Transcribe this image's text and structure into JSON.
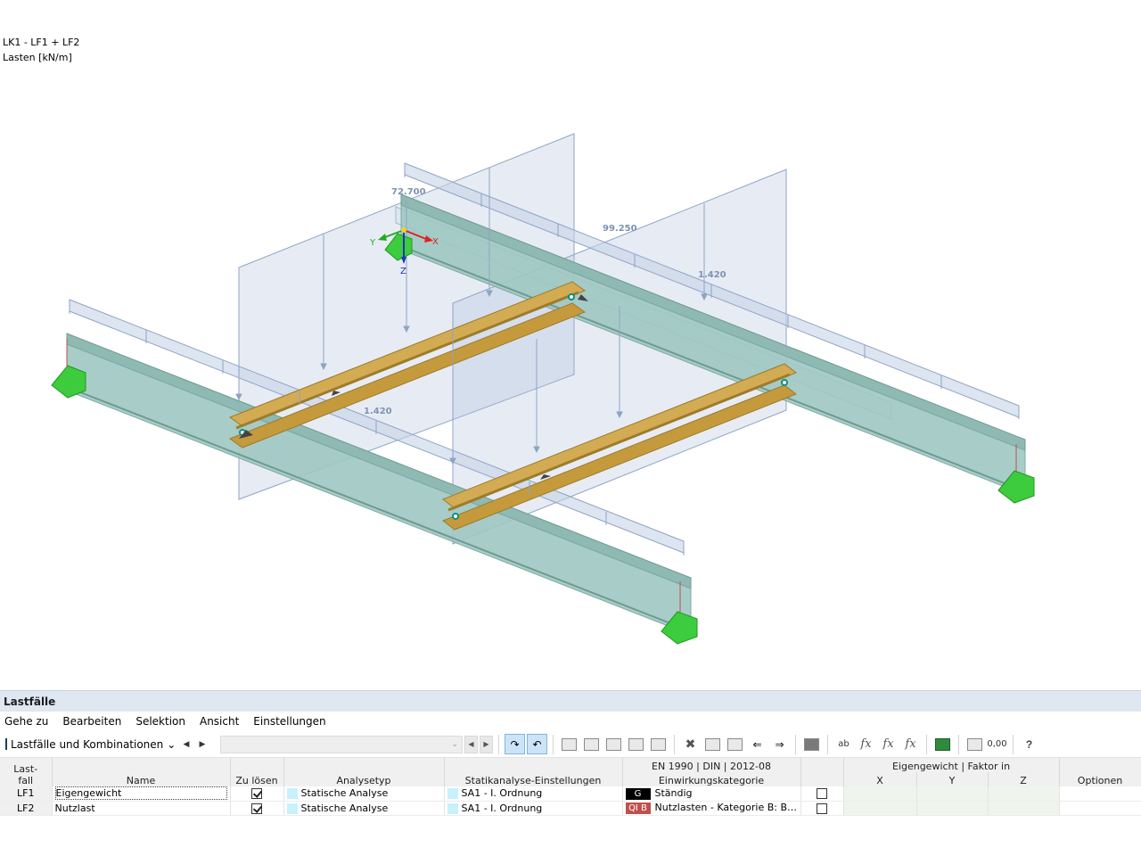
{
  "viewport": {
    "label_line1": "LK1 - LF1 + LF2",
    "label_line2": "Lasten [kN/m]",
    "load_values": [
      "72.700",
      "99.250",
      "1.420",
      "1.420"
    ],
    "axes": {
      "x": "X",
      "y": "Y",
      "z": "Z"
    },
    "colors": {
      "main_beam": "#9fc8c2",
      "cross_beam": "#c8a24a",
      "load_area": "#a9bbd6",
      "support": "#3dcc3d"
    }
  },
  "panel": {
    "title": "Lastfälle",
    "menu": [
      "Gehe zu",
      "Bearbeiten",
      "Selektion",
      "Ansicht",
      "Einstellungen"
    ],
    "toolbar": {
      "combo_label": "Lastfälle und Kombinationen",
      "combo_icon": "loadcase-icon",
      "zero_label": "0,00"
    },
    "table": {
      "headers": {
        "lastfall": "Last-\nfall",
        "name": "Name",
        "zu_loesen": "Zu lösen",
        "analysetyp": "Analysetyp",
        "statik": "Statikanalyse-Einstellungen",
        "norm_top": "EN 1990 | DIN | 2012-08",
        "norm_bottom": "Einwirkungskategorie",
        "eigengewicht": "Eigengewicht | Faktor in",
        "x": "X",
        "y": "Y",
        "z": "Z",
        "optionen": "Optionen"
      },
      "rows": [
        {
          "id": "LF1",
          "name": "Eigengewicht",
          "solve": true,
          "analysis": "Statische Analyse",
          "settings": "SA1 - I. Ordnung",
          "cat_code": "G",
          "cat_color": "#000000",
          "category": "Ständig",
          "selfweight": false
        },
        {
          "id": "LF2",
          "name": "Nutzlast",
          "solve": true,
          "analysis": "Statische Analyse",
          "settings": "SA1 - I. Ordnung",
          "cat_code": "QI B",
          "cat_color": "#c0504d",
          "category": "Nutzlasten - Kategorie B: Bür...",
          "selfweight": false
        }
      ]
    }
  }
}
